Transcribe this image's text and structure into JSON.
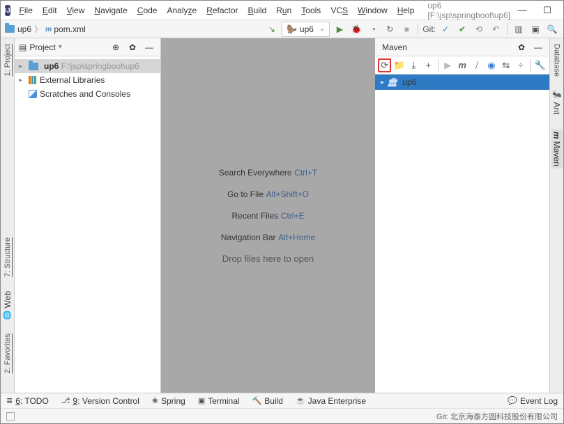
{
  "menu": {
    "file": "File",
    "edit": "Edit",
    "view": "View",
    "navigate": "Navigate",
    "code": "Code",
    "analyze": "Analyze",
    "refactor": "Refactor",
    "build": "Build",
    "run": "Run",
    "tools": "Tools",
    "vcs": "VCS",
    "window": "Window",
    "help": "Help"
  },
  "titlepath": "up6 [F:\\jsp\\springboot\\up6]",
  "breadcrumb": {
    "root": "up6",
    "file": "pom.xml"
  },
  "runconfig": "up6",
  "git_label": "Git:",
  "project": {
    "title": "Project",
    "root": {
      "name": "up6",
      "path": "F:\\jsp\\springboot\\up6"
    },
    "ext_libs": "External Libraries",
    "scratches": "Scratches and Consoles"
  },
  "welcome": {
    "l1": "Search Everywhere",
    "s1": "Ctrl+T",
    "l2": "Go to File",
    "s2": "Alt+Shift+O",
    "l3": "Recent Files",
    "s3": "Ctrl+E",
    "l4": "Navigation Bar",
    "s4": "Alt+Home",
    "l5": "Drop files here to open"
  },
  "maven": {
    "title": "Maven",
    "root": "up6"
  },
  "left_tabs": {
    "project": "1: Project",
    "structure": "7: Structure",
    "web": "Web",
    "favorites": "2: Favorites"
  },
  "right_tabs": {
    "database": "Database",
    "ant": "Ant",
    "maven": "Maven"
  },
  "footer": {
    "todo": "6: TODO",
    "vcs": "9: Version Control",
    "spring": "Spring",
    "terminal": "Terminal",
    "build": "Build",
    "javaee": "Java Enterprise",
    "eventlog": "Event Log"
  },
  "status": {
    "git": "Git: 北京海泰方圆科技股份有限公司"
  }
}
